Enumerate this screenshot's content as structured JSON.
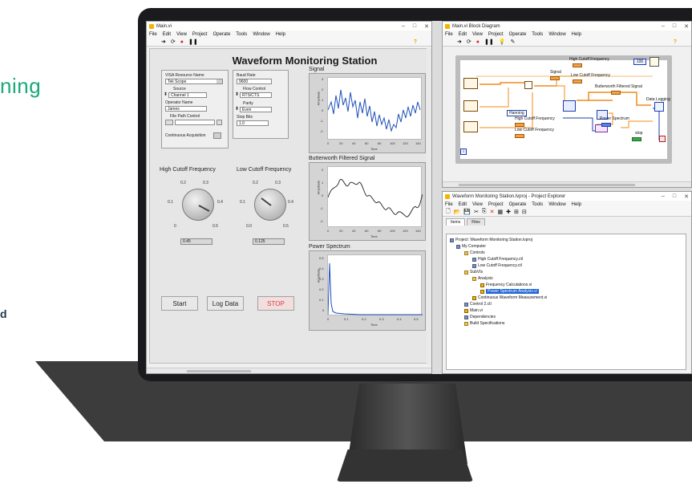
{
  "page": {
    "left_fragment_top": "ning",
    "left_fragment_bottom": "d"
  },
  "colors": {
    "accent_green": "#1aa97a",
    "stop_red": "#e23b3b",
    "plot_blue": "#1f4fb8",
    "labview_yellow": "#f6b400",
    "selection_blue": "#1d63d6"
  },
  "main_window": {
    "title": "Main.vi",
    "menu": [
      "File",
      "Edit",
      "View",
      "Project",
      "Operate",
      "Tools",
      "Window",
      "Help"
    ],
    "window_controls": [
      "–",
      "□",
      "✕"
    ],
    "toolbar_icons": [
      "run-arrow-icon",
      "run-continuous-icon",
      "abort-icon",
      "pause-icon"
    ],
    "panel_title": "Waveform Monitoring Station",
    "visa": {
      "resource_label": "VISA Resource Name",
      "resource_value": "Tek Scope",
      "source_label": "Source",
      "source_value": "Channel 1",
      "operator_label": "Operator Name",
      "operator_value": "James",
      "file_label": "File Path Control",
      "continuous_label": "Continuous Acquisition"
    },
    "serial": {
      "baud_label": "Baud Rate",
      "baud_value": "9600",
      "flow_label": "Flow Control",
      "flow_value": "RTS/CTS",
      "parity_label": "Parity",
      "parity_value": "Even",
      "stop_label": "Stop Bits",
      "stop_value": "1.0"
    },
    "high_knob": {
      "label": "High Cutoff Frequency",
      "ticks": [
        "0.2",
        "0.3",
        "0.1",
        "0.4",
        "0",
        "0.5"
      ],
      "value": "0.45"
    },
    "low_knob": {
      "label": "Low Cutoff Frequency",
      "ticks": [
        "0.2",
        "0.3",
        "0.1",
        "0.4",
        "0.0",
        "0.5"
      ],
      "value": "0.125"
    },
    "buttons": {
      "start": "Start",
      "log": "Log Data",
      "stop": "STOP"
    },
    "charts": {
      "signal_title": "Signal",
      "filtered_title": "Butterworth Filtered Signal",
      "spectrum_title": "Power Spectrum",
      "amp_label": "Amplitude",
      "time_label": "Time",
      "signal_yticks": [
        "3",
        "2",
        "1",
        "0",
        "-1",
        "-2"
      ],
      "filtered_yticks": [
        "2",
        "1",
        "0",
        "-1",
        "-2"
      ],
      "time_xticks": [
        "0",
        "20",
        "40",
        "60",
        "80",
        "100",
        "120",
        "140"
      ],
      "spectrum_yticks": [
        "0.5",
        "0.4",
        "0.3",
        "0.2",
        "0.1",
        "0"
      ],
      "spectrum_xticks": [
        "0",
        "0.1",
        "0.2",
        "0.3",
        "0.4",
        "0.5"
      ]
    }
  },
  "block_window": {
    "title": "Main.vi Block Diagram",
    "menu": [
      "File",
      "Edit",
      "View",
      "Project",
      "Operate",
      "Tools",
      "Window",
      "Help"
    ],
    "labels": {
      "signal": "Signal",
      "high_cutoff": "High Cutoff Frequency",
      "low_cutoff": "Low Cutoff Frequency",
      "butterworth": "Butterworth Filtered Signal",
      "data_logging": "Data Logging",
      "hanning": "Hanning",
      "high_cutoff_2": "High Cutoff Frequency",
      "low_cutoff_2": "Low Cutoff Frequency",
      "power_spectrum": "Power Spectrum",
      "stop": "stop",
      "loop_count": "i",
      "wait_ms": "100"
    }
  },
  "project_window": {
    "title": "Waveform Monitoring Station.lvproj - Project Explorer",
    "menu": [
      "File",
      "Edit",
      "View",
      "Project",
      "Operate",
      "Tools",
      "Window",
      "Help"
    ],
    "tabs": [
      "Items",
      "Files"
    ],
    "tree": [
      "Project: Waveform Monitoring Station.lvproj",
      "My Computer",
      "Controls",
      "High Cutoff Frequency.ctl",
      "Low Cutoff Frequency.ctl",
      "SubVIs",
      "Analysis",
      "Frequency Calculations.vi",
      "Power Spectrum Analysis.vi",
      "Continuous Waveform Measurement.vi",
      "Control 2.ctl",
      "Main.vi",
      "Dependencies",
      "Build Specifications"
    ]
  }
}
